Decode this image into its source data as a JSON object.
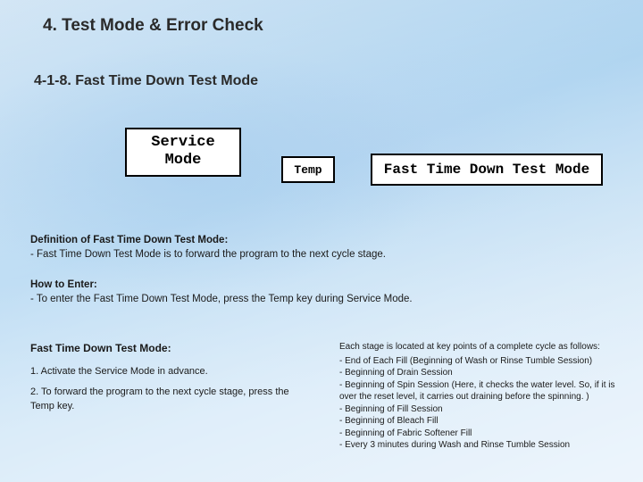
{
  "header": {
    "main_title": "4. Test Mode & Error Check",
    "subsection": "4-1-8.  Fast Time Down Test Mode"
  },
  "boxes": {
    "service": "Service\nMode",
    "temp": "Temp",
    "fast": "Fast Time Down Test Mode"
  },
  "definition": {
    "heading": "Definition of Fast Time Down Test Mode:",
    "body": "- Fast Time Down Test Mode is to forward the program to the next cycle stage."
  },
  "howto": {
    "heading": "How to Enter:",
    "body": "- To enter the Fast Time Down Test Mode, press the Temp key during Service Mode."
  },
  "left": {
    "heading": "Fast Time Down Test Mode:",
    "step1": "1. Activate the Service Mode in advance.",
    "step2": "2. To forward the program to the next cycle stage, press the Temp key."
  },
  "right": {
    "intro": "Each stage is located at key points of a complete cycle as follows:",
    "items": [
      "- End of Each Fill (Beginning of Wash or Rinse Tumble Session)",
      "- Beginning of Drain Session",
      "- Beginning of Spin Session (Here, it checks the water level. So, if it is over the reset level, it carries out draining before the spinning. )",
      "- Beginning of Fill Session",
      "- Beginning of Bleach Fill",
      "- Beginning of Fabric Softener Fill",
      "- Every 3 minutes during Wash and Rinse Tumble Session"
    ]
  }
}
